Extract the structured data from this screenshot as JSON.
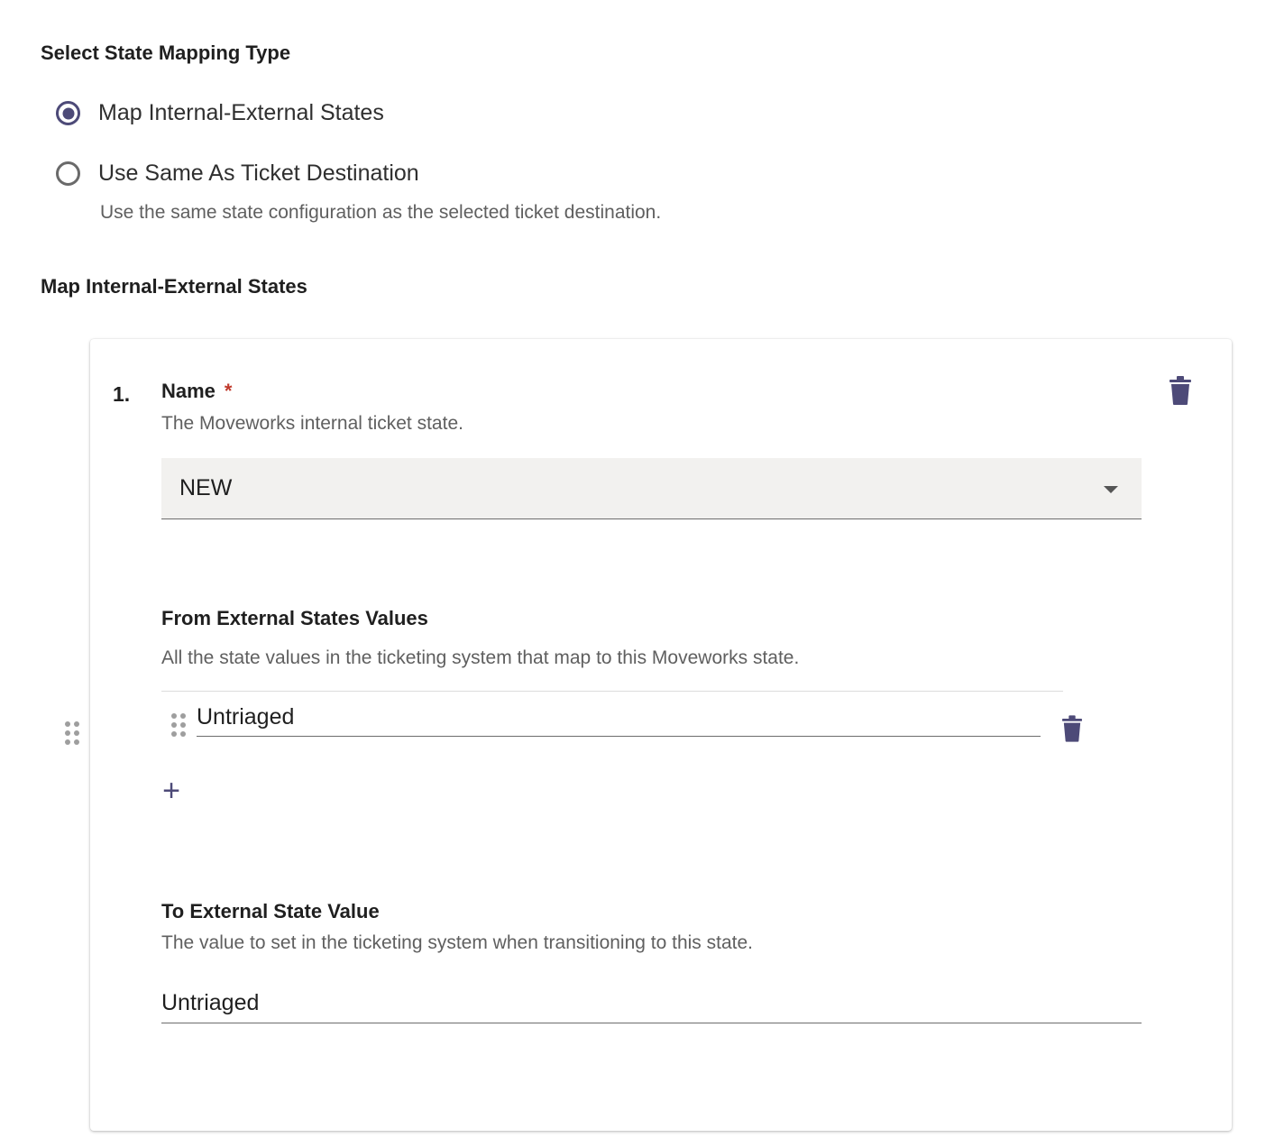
{
  "state_mapping_type": {
    "title": "Select State Mapping Type",
    "options": [
      {
        "label": "Map Internal-External States",
        "selected": true
      },
      {
        "label": "Use Same As Ticket Destination",
        "selected": false,
        "helper": "Use the same state configuration as the selected ticket destination."
      }
    ]
  },
  "mapping_section": {
    "title": "Map Internal-External States",
    "items": [
      {
        "index": "1.",
        "name_field": {
          "label": "Name",
          "required_mark": "*",
          "helper": "The Moveworks internal ticket state.",
          "value": "NEW"
        },
        "from_external": {
          "label": "From External States Values",
          "helper": "All the state values in the ticketing system that map to this Moveworks state.",
          "values": [
            "Untriaged"
          ],
          "add_label": "+"
        },
        "to_external": {
          "label": "To External State Value",
          "helper": "The value to set in the ticketing system when transitioning to this state.",
          "value": "Untriaged"
        }
      }
    ]
  },
  "colors": {
    "accent": "#4d4a78",
    "required": "#c0392b",
    "select_bg": "#f2f1ef",
    "muted_text": "#5f5f5f"
  },
  "icons": {
    "delete": "trash-icon",
    "drag": "drag-handle-icon",
    "add": "plus-icon",
    "dropdown": "caret-down-icon"
  }
}
